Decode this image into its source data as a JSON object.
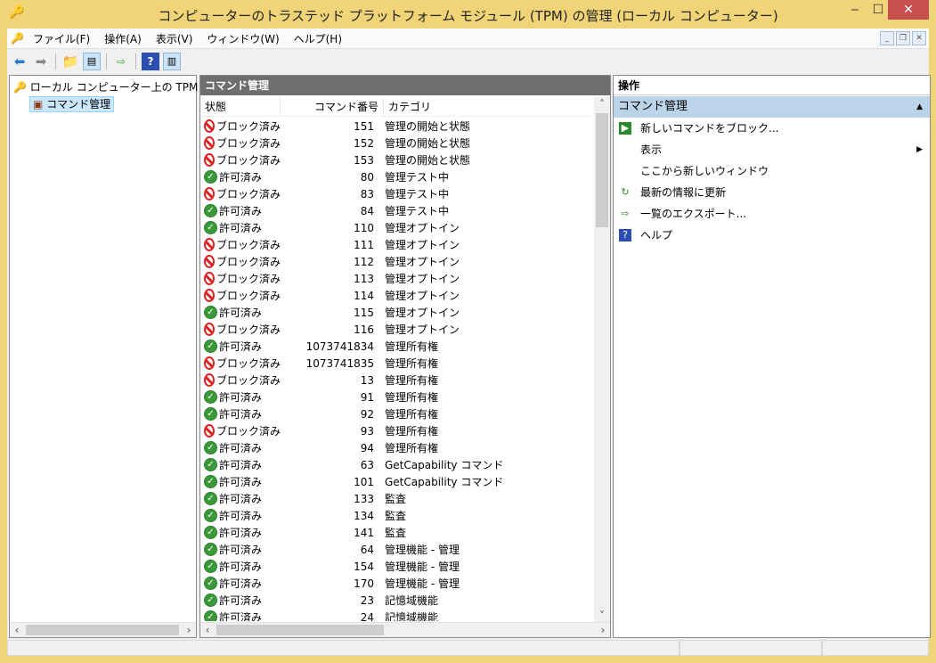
{
  "window": {
    "title": "コンピューターのトラステッド プラットフォーム モジュール (TPM) の管理 (ローカル コンピューター)",
    "minimize": "‒",
    "maximize": "☐",
    "close": "✕"
  },
  "menu": [
    "ファイル(F)",
    "操作(A)",
    "表示(V)",
    "ウィンドウ(W)",
    "ヘルプ(H)"
  ],
  "tree": {
    "root": "ローカル コンピューター上の TPM 管理",
    "child": "コマンド管理"
  },
  "center": {
    "title": "コマンド管理",
    "columns": [
      "状態",
      "コマンド番号",
      "カテゴリ"
    ],
    "status_labels": {
      "blocked": "ブロック済み",
      "allowed": "許可済み"
    },
    "rows": [
      [
        "blocked",
        "151",
        "管理の開始と状態"
      ],
      [
        "blocked",
        "152",
        "管理の開始と状態"
      ],
      [
        "blocked",
        "153",
        "管理の開始と状態"
      ],
      [
        "allowed",
        "80",
        "管理テスト中"
      ],
      [
        "blocked",
        "83",
        "管理テスト中"
      ],
      [
        "allowed",
        "84",
        "管理テスト中"
      ],
      [
        "allowed",
        "110",
        "管理オプトイン"
      ],
      [
        "blocked",
        "111",
        "管理オプトイン"
      ],
      [
        "blocked",
        "112",
        "管理オプトイン"
      ],
      [
        "blocked",
        "113",
        "管理オプトイン"
      ],
      [
        "blocked",
        "114",
        "管理オプトイン"
      ],
      [
        "allowed",
        "115",
        "管理オプトイン"
      ],
      [
        "blocked",
        "116",
        "管理オプトイン"
      ],
      [
        "allowed",
        "1073741834",
        "管理所有権"
      ],
      [
        "blocked",
        "1073741835",
        "管理所有権"
      ],
      [
        "blocked",
        "13",
        "管理所有権"
      ],
      [
        "allowed",
        "91",
        "管理所有権"
      ],
      [
        "allowed",
        "92",
        "管理所有権"
      ],
      [
        "blocked",
        "93",
        "管理所有権"
      ],
      [
        "allowed",
        "94",
        "管理所有権"
      ],
      [
        "allowed",
        "63",
        "GetCapability コマンド"
      ],
      [
        "allowed",
        "101",
        "GetCapability コマンド"
      ],
      [
        "allowed",
        "133",
        "監査"
      ],
      [
        "allowed",
        "134",
        "監査"
      ],
      [
        "allowed",
        "141",
        "監査"
      ],
      [
        "allowed",
        "64",
        "管理機能 - 管理"
      ],
      [
        "allowed",
        "154",
        "管理機能 - 管理"
      ],
      [
        "allowed",
        "170",
        "管理機能 - 管理"
      ],
      [
        "allowed",
        "23",
        "記憶域機能"
      ],
      [
        "allowed",
        "24",
        "記憶域機能"
      ]
    ]
  },
  "actions": {
    "title": "操作",
    "section": "コマンド管理",
    "items": [
      {
        "label": "新しいコマンドをブロック...",
        "icon": "block-command-icon"
      },
      {
        "label": "表示",
        "icon": "",
        "submenu": true
      },
      {
        "label": "ここから新しいウィンドウ",
        "icon": ""
      },
      {
        "label": "最新の情報に更新",
        "icon": "refresh-icon"
      },
      {
        "label": "一覧のエクスポート...",
        "icon": "export-list-icon"
      },
      {
        "label": "ヘルプ",
        "icon": "help-icon"
      }
    ]
  }
}
